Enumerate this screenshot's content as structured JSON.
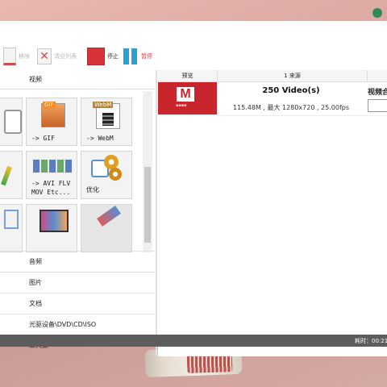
{
  "toolbar": {
    "remove_label": "移除",
    "clear_label": "清空列表",
    "stop_label": "停止",
    "pause_label": "暂停"
  },
  "left_panel": {
    "category_video": "视频",
    "tiles": [
      {
        "label": ""
      },
      {
        "badge": "GIF",
        "label": "-> GIF"
      },
      {
        "badge": "WebM",
        "label": "-> WebM"
      },
      {
        "label": ""
      },
      {
        "label": "-> AVI FLV\nMOV Etc..."
      },
      {
        "label": "优化"
      },
      {
        "label": ""
      },
      {
        "label": ""
      },
      {
        "label": ""
      }
    ],
    "categories": [
      "音频",
      "图片",
      "文档",
      "光驱设备\\DVD\\CD\\ISO",
      "工具集"
    ]
  },
  "file_list": {
    "col_preview": "预览",
    "col_source": "1 来源",
    "items": [
      {
        "logo": "M",
        "title": "250 Video(s)",
        "info": "115.48M , 最大 1280x720 , 25.00fps",
        "output_label": "视频合"
      }
    ]
  },
  "status": {
    "elapsed": "耗时：00:21"
  },
  "colors": {
    "stop": "#d9333a",
    "pause": "#2aa0d9",
    "preview_bg": "#c8262c",
    "statusbar": "#5d5d5d"
  }
}
